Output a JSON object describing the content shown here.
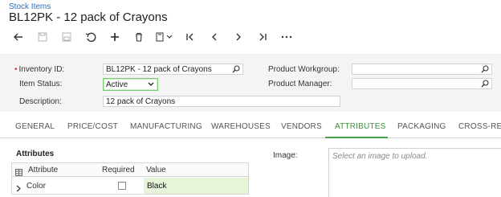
{
  "breadcrumb": "Stock Items",
  "title": "BL12PK - 12 pack of Crayons",
  "toolbar": {
    "items": [
      {
        "name": "back-arrow-icon"
      },
      {
        "name": "save-icon"
      },
      {
        "name": "save-close-icon"
      },
      {
        "name": "undo-icon"
      },
      {
        "name": "add-icon"
      },
      {
        "name": "delete-icon"
      },
      {
        "name": "copy-paste-icon"
      },
      {
        "name": "first-record-icon"
      },
      {
        "name": "previous-record-icon"
      },
      {
        "name": "next-record-icon"
      },
      {
        "name": "last-record-icon"
      },
      {
        "name": "more-icon"
      }
    ]
  },
  "form": {
    "inventory_id_label": "Inventory ID:",
    "inventory_id_value": "BL12PK - 12 pack of Crayons",
    "item_status_label": "Item Status:",
    "item_status_value": "Active",
    "description_label": "Description:",
    "description_value": "12 pack of Crayons",
    "product_workgroup_label": "Product Workgroup:",
    "product_workgroup_value": "",
    "product_manager_label": "Product Manager:",
    "product_manager_value": ""
  },
  "tabs": [
    {
      "label": "GENERAL"
    },
    {
      "label": "PRICE/COST"
    },
    {
      "label": "MANUFACTURING"
    },
    {
      "label": "WAREHOUSES"
    },
    {
      "label": "VENDORS"
    },
    {
      "label": "ATTRIBUTES"
    },
    {
      "label": "PACKAGING"
    },
    {
      "label": "CROSS-REF"
    }
  ],
  "selected_tab": "ATTRIBUTES",
  "attributes": {
    "section_title": "Attributes",
    "columns": {
      "attribute": "Attribute",
      "required": "Required",
      "value": "Value"
    },
    "rows": [
      {
        "attribute": "Color",
        "required": false,
        "value": "Black"
      }
    ]
  },
  "image": {
    "label": "Image:",
    "placeholder": "Select an image to upload."
  },
  "colors": {
    "accent": "#4aa34a",
    "link": "#2f6fb3",
    "value_cell_bg": "#e6f4d9"
  }
}
